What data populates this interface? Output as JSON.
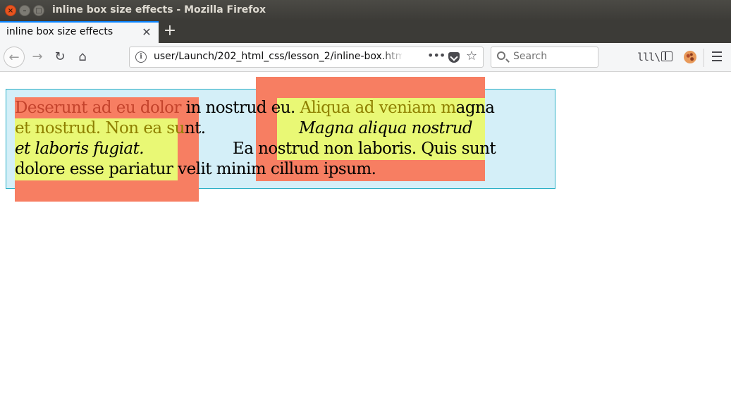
{
  "window": {
    "title": "inline box size effects - Mozilla Firefox",
    "close_glyph": "×",
    "min_glyph": "–",
    "max_glyph": "□"
  },
  "tabs": [
    {
      "title": "inline box size effects",
      "close_glyph": "✕"
    }
  ],
  "new_tab_glyph": "+",
  "nav": {
    "back_glyph": "←",
    "forward_glyph": "→",
    "reload_glyph": "↻",
    "home_glyph": "⌂",
    "url": "user/Launch/202_html_css/lesson_2/inline-box.html",
    "info_glyph": "i",
    "dots_glyph": "•••",
    "star_glyph": "☆",
    "search_placeholder": "Search",
    "library_glyph": "lll\\"
  },
  "icons": [
    "back-icon",
    "forward-icon",
    "reload-icon",
    "home-icon",
    "info-icon",
    "page-actions-icon",
    "pocket-icon",
    "bookmark-star-icon",
    "search-icon",
    "library-icon",
    "sidebar-icon",
    "cookie-extension-icon",
    "hamburger-menu-icon"
  ],
  "page": {
    "line1_a": "Deserunt ad eu dolor",
    "line1_b": " in nostrud eu. ",
    "line1_c": "Aliqua ad veniam m",
    "line1_d": "agna",
    "line2_a": "et nostrud. Non ea su",
    "line2_b": "nt.",
    "line2_c": "Magna aliqua nostrud",
    "line3_a": "et laboris fugiat.",
    "line3_b": "Ea nostrud non laboris. Quis sunt",
    "line4": "dolore esse pariatur velit minim cillum ipsum."
  },
  "colors": {
    "paragraph_bg": "#d4eff8",
    "paragraph_border": "#2bb0c6",
    "padding_area": "#f77e62",
    "content_area": "#e9f875"
  }
}
